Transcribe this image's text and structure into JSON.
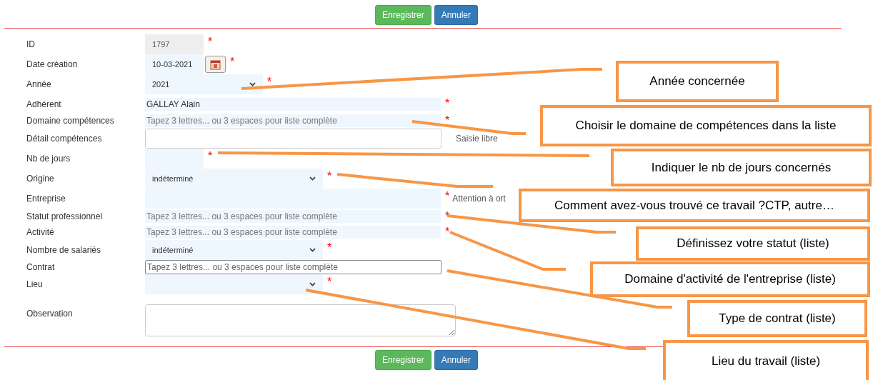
{
  "top_actions": [
    {
      "kind": "save",
      "label": "Enregistrer"
    },
    {
      "kind": "cancel",
      "label": "Annuler"
    }
  ],
  "fields": [
    {
      "label": "ID",
      "kind": "readonly",
      "value": "1797",
      "required_mark": "*"
    },
    {
      "label": "Date création",
      "kind": "date",
      "value": "10-03-2021",
      "required_mark": "*"
    },
    {
      "label": "Année",
      "kind": "year-select",
      "value": "2021",
      "required_mark": "*"
    },
    {
      "label": "Adhérent",
      "kind": "text",
      "value": "GALLAY Alain",
      "required_mark": "*"
    },
    {
      "label": "Domaine compétences",
      "kind": "autocomplete",
      "placeholder": "Tapez 3 lettres... ou 3 espaces pour liste complète",
      "required_mark": "*"
    },
    {
      "label": "Détail compétences",
      "kind": "input",
      "note": "Saisie libre"
    },
    {
      "label": "Nb de jours",
      "kind": "number",
      "required_mark": "*"
    },
    {
      "label": "Origine",
      "kind": "select",
      "value": "indéterminé",
      "required_mark": "*"
    },
    {
      "label": "Entreprise",
      "kind": "wide-input",
      "required_mark": "*",
      "note": "Attention à ort"
    },
    {
      "label": "Statut professionnel",
      "kind": "autocomplete",
      "placeholder": "Tapez 3 lettres... ou 3 espaces pour liste complète",
      "required_mark": "*"
    },
    {
      "label": "Activité",
      "kind": "autocomplete",
      "placeholder": "Tapez 3 lettres... ou 3 espaces pour liste complète",
      "required_mark": "*"
    },
    {
      "label": "Nombre de salariés",
      "kind": "select",
      "value": "indéterminé",
      "required_mark": "*"
    },
    {
      "label": "Contrat",
      "kind": "bordered",
      "placeholder": "Tapez 3 lettres... ou 3 espaces pour liste complète"
    },
    {
      "label": "Lieu",
      "kind": "select",
      "required_mark": "*"
    },
    {
      "label": "Observation",
      "kind": "textarea"
    }
  ],
  "bottom_actions": [
    {
      "kind": "save",
      "label": "Enregistrer"
    },
    {
      "kind": "cancel",
      "label": "Annuler"
    }
  ],
  "annotations": [
    {
      "text": "Année concernée"
    },
    {
      "text": "Choisir le domaine de compétences dans la liste"
    },
    {
      "text": "Indiquer le nb de jours concernés"
    },
    {
      "text": "Comment avez-vous trouvé ce travail ?CTP, autre…"
    },
    {
      "text": "Définissez votre statut (liste)"
    },
    {
      "text": "Domaine d'activité de l'entreprise (liste)"
    },
    {
      "text": "Type de contrat (liste)"
    },
    {
      "text": "Lieu du travail (liste)"
    }
  ]
}
